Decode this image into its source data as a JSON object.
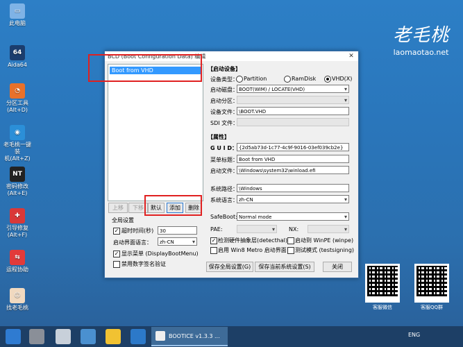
{
  "desktop": {
    "icons": [
      {
        "label": "此电脑",
        "glyph": "▭",
        "color": "#7fb3e6"
      },
      {
        "label": "Aida64",
        "glyph": "64",
        "color": "#1b3d6e"
      },
      {
        "label": "分区工具\n(Alt+D)",
        "glyph": "◔",
        "color": "#e8712a"
      },
      {
        "label": "老毛桃一键装\n机(Alt+Z)",
        "glyph": "◉",
        "color": "#2b8fd8"
      },
      {
        "label": "密码修改\n(Alt+E)",
        "glyph": "NT",
        "color": "#222222"
      },
      {
        "label": "引导修复\n(Alt+F)",
        "glyph": "✚",
        "color": "#d93838"
      },
      {
        "label": "运程协助",
        "glyph": "⇆",
        "color": "#e23a3a"
      },
      {
        "label": "找老毛桃",
        "glyph": "☺",
        "color": "#f0d9c0"
      }
    ],
    "brand": {
      "logo_text": "老毛桃",
      "site": "laomaotao.net"
    },
    "qr_left_caption": "客服微信",
    "qr_right_caption": "客服QQ群"
  },
  "window": {
    "title": "BCD (Boot Configuration Data) 编辑",
    "close_glyph": "✕",
    "list_items": [
      "Boot from VHD"
    ],
    "buttons": {
      "up": "上移",
      "down": "下移",
      "default": "默认",
      "add": "添加",
      "delete": "删除",
      "save_global": "保存全局设置(G)",
      "save_current": "保存当前系统设置(S)",
      "close": "关闭"
    },
    "global": {
      "header": "全局设置",
      "timeout_label": "超时时间(秒)",
      "timeout_value": "30",
      "timeout_checked": true,
      "lang_label": "启动界面语言：",
      "lang_value": "zh-CN",
      "show_menu_label": "显示菜单 (DisplayBootMenu)",
      "show_menu_checked": true,
      "no_sig_label": "禁用数字签名验证",
      "no_sig_checked": false
    },
    "boot_device": {
      "header": "【启动设备】",
      "type_label": "设备类型：",
      "type_options": [
        "Partition",
        "RamDisk",
        "VHD(X)"
      ],
      "type_selected": "VHD(X)",
      "disk_label": "启动磁盘：",
      "disk_value": "BOOT(WIM) / LOCATE(VHD)",
      "partition_label": "启动分区：",
      "partition_value": "",
      "file_label": "设备文件：",
      "file_value": "\\BOOT.VHD",
      "sdi_label": "SDI 文件：",
      "sdi_value": ""
    },
    "attributes": {
      "header": "【属性】",
      "guid_label": "G U I D：",
      "guid_value": "{2d5ab73d-1c77-4c9f-9016-03ef039cb2e}",
      "title_label": "菜单标题：",
      "title_value": "Boot from VHD",
      "bootfile_label": "启动文件：",
      "bootfile_value": "\\Windows\\system32\\winload.efi",
      "syspath_label": "系统路径：",
      "syspath_value": "\\Windows",
      "syslang_label": "系统语言：",
      "syslang_value": "zh-CN",
      "safeboot_label": "SafeBoot:",
      "safeboot_value": "Normal mode",
      "pae_label": "PAE:",
      "pae_value": "",
      "nx_label": "NX:",
      "nx_value": "",
      "detecthal_label": "检测硬件抽象层(detecthal)",
      "detecthal_checked": true,
      "winpe_label": "启动到 WinPE (winpe)",
      "winpe_checked": false,
      "win8menu_label": "启用 Win8 Metro 启动界面",
      "win8menu_checked": false,
      "testsign_label": "测试模式 (testsigning)",
      "testsign_checked": false
    }
  },
  "taskbar": {
    "task_label": "BOOTICE v1.3.3 ...",
    "lang": "ENG"
  },
  "colors": {
    "accent": "#3399ff",
    "highlight": "#e02020",
    "taskbar": "#1d3f66"
  }
}
